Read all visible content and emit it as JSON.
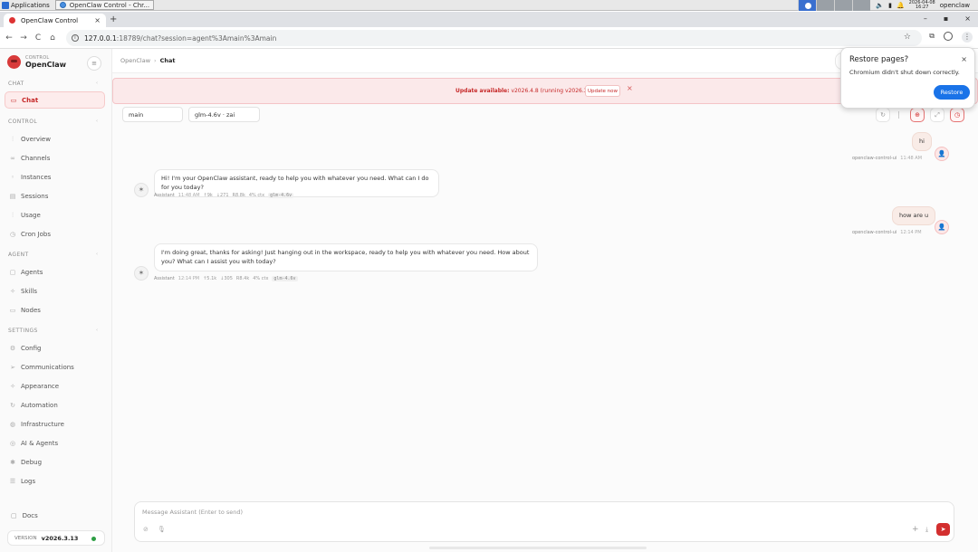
{
  "os": {
    "apps_label": "Applications",
    "task_label": "OpenClaw Control - Chr...",
    "date": "2026-04-08",
    "time": "16:27",
    "user": "openclaw"
  },
  "browser": {
    "tab_title": "OpenClaw Control",
    "url_host": "127.0.0.1",
    "url_rest": ":18789/chat?session=agent%3Amain%3Amain"
  },
  "restore_popup": {
    "title": "Restore pages?",
    "message": "Chromium didn't shut down correctly.",
    "button": "Restore"
  },
  "sidebar": {
    "brand_small": "CONTROL",
    "brand_name": "OpenClaw",
    "sections": {
      "chat": "CHAT",
      "control": "CONTROL",
      "agent": "AGENT",
      "settings": "SETTINGS"
    },
    "items": {
      "chat": "Chat",
      "overview": "Overview",
      "channels": "Channels",
      "instances": "Instances",
      "sessions": "Sessions",
      "usage": "Usage",
      "cron_jobs": "Cron Jobs",
      "agents": "Agents",
      "skills": "Skills",
      "nodes": "Nodes",
      "config": "Config",
      "communications": "Communications",
      "appearance": "Appearance",
      "automation": "Automation",
      "infrastructure": "Infrastructure",
      "ai_agents": "AI & Agents",
      "debug": "Debug",
      "logs": "Logs"
    },
    "docs": "Docs",
    "version_label": "VERSION",
    "version": "v2026.3.13",
    "status_color": "#2e9e44"
  },
  "main": {
    "breadcrumb_root": "OpenClaw",
    "breadcrumb_sep": "›",
    "breadcrumb_current": "Chat",
    "banner": {
      "label": "Update available:",
      "text": " v2026.4.8 (running v2026.3.13).",
      "button": "Update now"
    },
    "session_select": "main",
    "model_select": "glm-4.6v · zai",
    "messages": [
      {
        "role": "user",
        "text": "hi",
        "sender": "openclaw-control-ui",
        "time": "11:48 AM"
      },
      {
        "role": "assistant",
        "text": "Hi! I'm your OpenClaw assistant, ready to help you with whatever you need. What can I do for you today?",
        "sender": "Assistant",
        "time": "11:48 AM",
        "tokens_in": "↑9k",
        "tokens_out": "↓271",
        "cache": "R8.8k",
        "ctx": "4% ctx",
        "model": "glm-4.6v"
      },
      {
        "role": "user",
        "text": "how are u",
        "sender": "openclaw-control-ui",
        "time": "12:14 PM"
      },
      {
        "role": "assistant",
        "text": "I'm doing great, thanks for asking! Just hanging out in the workspace, ready to help you with whatever you need. How about you? What can I assist you with today?",
        "sender": "Assistant",
        "time": "12:14 PM",
        "tokens_in": "↑5.1k",
        "tokens_out": "↓305",
        "cache": "R8.4k",
        "ctx": "4% ctx",
        "model": "glm-4.6v"
      }
    ],
    "composer_placeholder": "Message Assistant (Enter to send)"
  },
  "colors": {
    "accent": "#d32f2f",
    "banner_bg": "#fbe9ea",
    "restore_button": "#1a73e8"
  }
}
